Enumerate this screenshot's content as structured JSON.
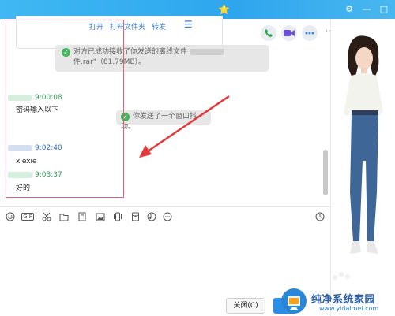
{
  "window": {
    "title": "",
    "star": "⭐",
    "controls": {
      "settings": "⚙",
      "minimize": "—",
      "maximize": "□"
    }
  },
  "toolbar_top": {
    "call_icon": "phone-icon",
    "video_icon": "video-icon",
    "more_icon": "more-icon"
  },
  "file_card": {
    "actions": [
      "打开",
      "打开文件夹",
      "转发"
    ],
    "menu_icon": "☰"
  },
  "notices": [
    {
      "line1": "对方已成功接收了你发送的离线文件",
      "line2": "件.rar\"（81.79MB）。"
    },
    {
      "text": "你发送了一个窗口抖动。"
    }
  ],
  "messages": [
    {
      "time": "9:00:08",
      "text": "密码输入以下",
      "time_color": "#2e9e55"
    },
    {
      "time": "9:02:40",
      "text": "xiexie",
      "time_color": "#2a6bd6"
    },
    {
      "time": "9:03:37",
      "text": "好的",
      "time_color": "#2e9e55"
    }
  ],
  "input_toolbar": [
    "emoji-icon",
    "gif-icon",
    "scissors-icon",
    "folder-icon",
    "doc-icon",
    "image-icon",
    "shake-icon",
    "redpacket-icon",
    "music-icon",
    "more-icon",
    "history-icon"
  ],
  "gif_label": "GIF",
  "buttons": {
    "close": "关闭(C)"
  },
  "watermark": {
    "title": "纯净系统家园",
    "url": "www.yidaimei.com"
  },
  "colors": {
    "titlebar": "#33aef0",
    "accent": "#2b8ee6",
    "annotation": "#e0607a",
    "arrow": "#e23a3a"
  }
}
